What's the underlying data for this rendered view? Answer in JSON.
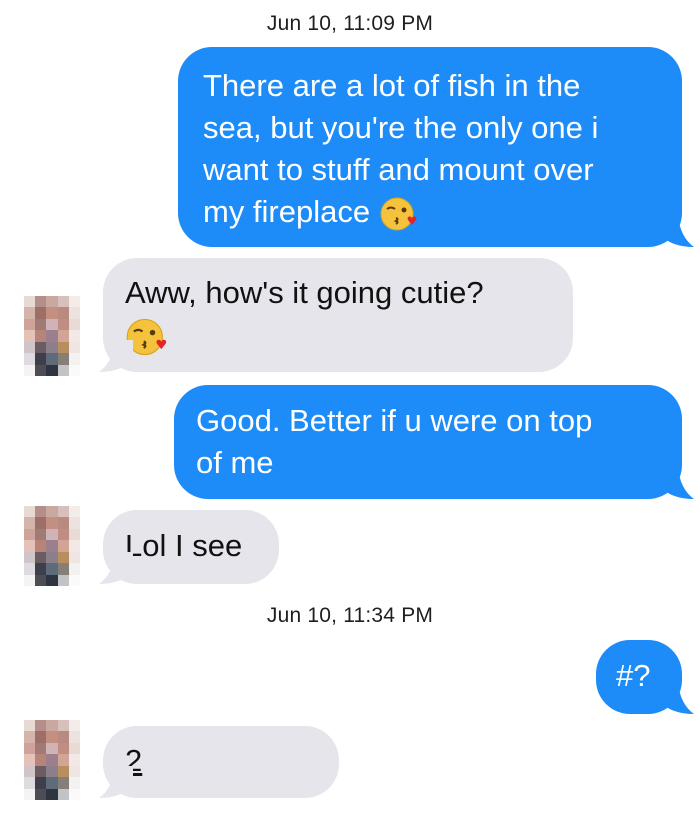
{
  "conversation": {
    "timestamp_1": "Jun 10, 11:09 PM",
    "timestamp_2": "Jun 10, 11:34 PM",
    "messages": [
      {
        "from": "me",
        "text_lines": [
          "There are a lot of fish in the",
          "sea, but you're the only one i",
          "want to stuff and mount over",
          "my fireplace"
        ],
        "emoji": "face-blowing-kiss"
      },
      {
        "from": "them",
        "text_lines": [
          "Aww, how's it going cutie?"
        ],
        "emoji": "face-blowing-kiss"
      },
      {
        "from": "me",
        "text_lines": [
          "Good. Better if u were on top",
          "of me"
        ]
      },
      {
        "from": "them",
        "text_lines": [
          "Lol I see"
        ]
      },
      {
        "from": "me",
        "text_lines": [
          "#?"
        ]
      },
      {
        "from": "them",
        "text_lines": [
          "2"
        ]
      }
    ]
  },
  "colors": {
    "outgoing_bubble": "#1e8cf8",
    "incoming_bubble": "#e6e5eb",
    "outgoing_text": "#ffffff",
    "incoming_text": "#111111"
  }
}
